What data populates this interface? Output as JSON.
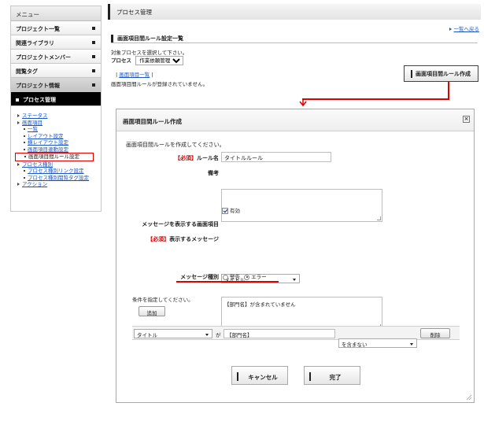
{
  "sidebar": {
    "menu_label": "メニュー",
    "items": [
      {
        "label": "プロジェクト一覧"
      },
      {
        "label": "関連ライブラリ"
      },
      {
        "label": "プロジェクトメンバー"
      },
      {
        "label": "閲覧タグ"
      },
      {
        "label": "プロジェクト情報"
      },
      {
        "label": "プロセス管理"
      }
    ],
    "tree": {
      "status": "ステータス",
      "screen_items": "画面項目",
      "list": "一覧",
      "layout_settings": "レイアウト設定",
      "horizontal_layout": "横レイアウト設定",
      "item_link_settings": "画面項目連動設定",
      "rule_settings": "画面項目間ルール設定",
      "process_types": "プロセス種別",
      "type_link_settings": "プロセス種別リンク設定",
      "type_tag_settings": "プロセス種別閲覧タグ設定",
      "actions": "アクション"
    }
  },
  "main": {
    "page_title": "プロセス管理",
    "back_link": "一覧へ戻る",
    "section_title": "画面項目間ルール設定一覧",
    "select_process_note": "対象プロセスを選択して下さい。",
    "process_label": "プロセス",
    "process_value": "作業依頼管理",
    "tab_link": "画面項目一覧",
    "empty_message": "画面項目間ルールが登録されていません。",
    "create_button": "画面項目間ルール作成"
  },
  "modal": {
    "title": "画面項目間ルール作成",
    "close_glyph": "×",
    "intro": "画面項目間ルールを作成してください。",
    "required_tag": "【必須】",
    "rule_name_label": "ルール名",
    "rule_name_value": "タイトルルール",
    "remarks_label": "備考",
    "remarks_value": "",
    "enabled_label": "有効",
    "screen_item_label": "メッセージを表示する画面項目",
    "screen_item_value": "タイトル",
    "display_message_label": "表示するメッセージ",
    "display_message_value": "【部門名】が含まれていません",
    "message_type_label": "メッセージ種別",
    "message_type_options": [
      "警告",
      "エラー"
    ],
    "message_type_selected": "エラー",
    "condition_intro": "条件を指定してください。",
    "add_button": "追加",
    "condition": {
      "field": "タイトル",
      "particle": "が",
      "value": "【部門名】",
      "operator": "を含まない",
      "delete_button": "削除"
    },
    "cancel_button": "キャンセル",
    "done_button": "完了"
  },
  "colors": {
    "highlight": "#e00000",
    "link": "#1a55c8",
    "required": "#d00000"
  }
}
